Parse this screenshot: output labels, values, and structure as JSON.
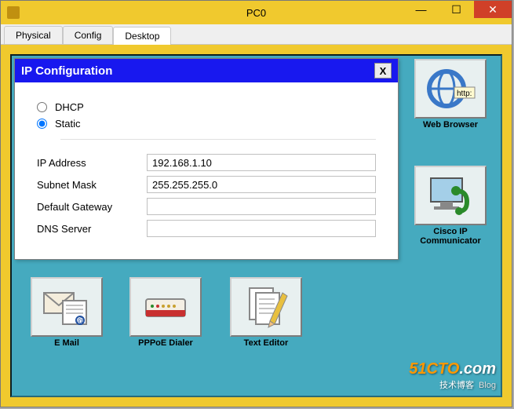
{
  "window": {
    "title": "PC0"
  },
  "tabs": {
    "physical": "Physical",
    "config": "Config",
    "desktop": "Desktop"
  },
  "apps": {
    "web": "Web Browser",
    "cisco": "Cisco IP Communicator",
    "email": "E Mail",
    "pppoe": "PPPoE Dialer",
    "text": "Text Editor"
  },
  "dialog": {
    "title": "IP Configuration",
    "dhcp": "DHCP",
    "static": "Static",
    "fields": {
      "ip_label": "IP Address",
      "ip_value": "192.168.1.10",
      "mask_label": "Subnet Mask",
      "mask_value": "255.255.255.0",
      "gw_label": "Default Gateway",
      "gw_value": "",
      "dns_label": "DNS Server",
      "dns_value": ""
    }
  },
  "watermark": {
    "brand": "51CTO",
    "suffix": ".com",
    "sub": "技术博客",
    "blog": "Blog"
  }
}
